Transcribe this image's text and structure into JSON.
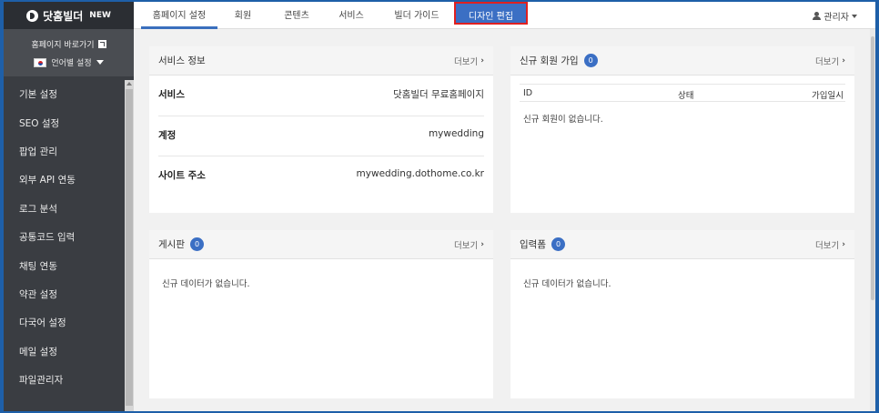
{
  "brand": {
    "name": "닷홈빌더",
    "badge": "NEW"
  },
  "sidebar": {
    "homepage_link": "홈페이지 바로가기",
    "language_setting": "언어별 설정",
    "items": [
      {
        "label": "기본 설정"
      },
      {
        "label": "SEO 설정"
      },
      {
        "label": "팝업 관리"
      },
      {
        "label": "외부 API 연동"
      },
      {
        "label": "로그 분석"
      },
      {
        "label": "공통코드 입력"
      },
      {
        "label": "채팅 연동"
      },
      {
        "label": "약관 설정"
      },
      {
        "label": "다국어 설정"
      },
      {
        "label": "메일 설정"
      },
      {
        "label": "파일관리자"
      }
    ]
  },
  "nav": {
    "tabs": [
      {
        "label": "홈페이지 설정"
      },
      {
        "label": "회원"
      },
      {
        "label": "콘텐츠"
      },
      {
        "label": "서비스"
      },
      {
        "label": "빌더 가이드"
      },
      {
        "label": "디자인 편집"
      }
    ],
    "admin": "관리자"
  },
  "service_panel": {
    "title": "서비스 정보",
    "more": "더보기",
    "rows": [
      {
        "key": "서비스",
        "value": "닷홈빌더 무료홈페이지"
      },
      {
        "key": "계정",
        "value": "mywedding"
      },
      {
        "key": "사이트 주소",
        "value": "mywedding.dothome.co.kr"
      }
    ]
  },
  "signup_panel": {
    "title": "신규 회원 가입",
    "count": "0",
    "more": "더보기",
    "columns": [
      "ID",
      "상태",
      "가입일시"
    ],
    "empty": "신규 회원이 없습니다."
  },
  "board_panel": {
    "title": "게시판",
    "count": "0",
    "more": "더보기",
    "empty": "신규 데이터가 없습니다."
  },
  "form_panel": {
    "title": "입력폼",
    "count": "0",
    "more": "더보기",
    "empty": "신규 데이터가 없습니다."
  },
  "colors": {
    "accent": "#3b6fc4",
    "highlight_border": "#e02020",
    "sidebar_bg": "#3a3d42"
  }
}
